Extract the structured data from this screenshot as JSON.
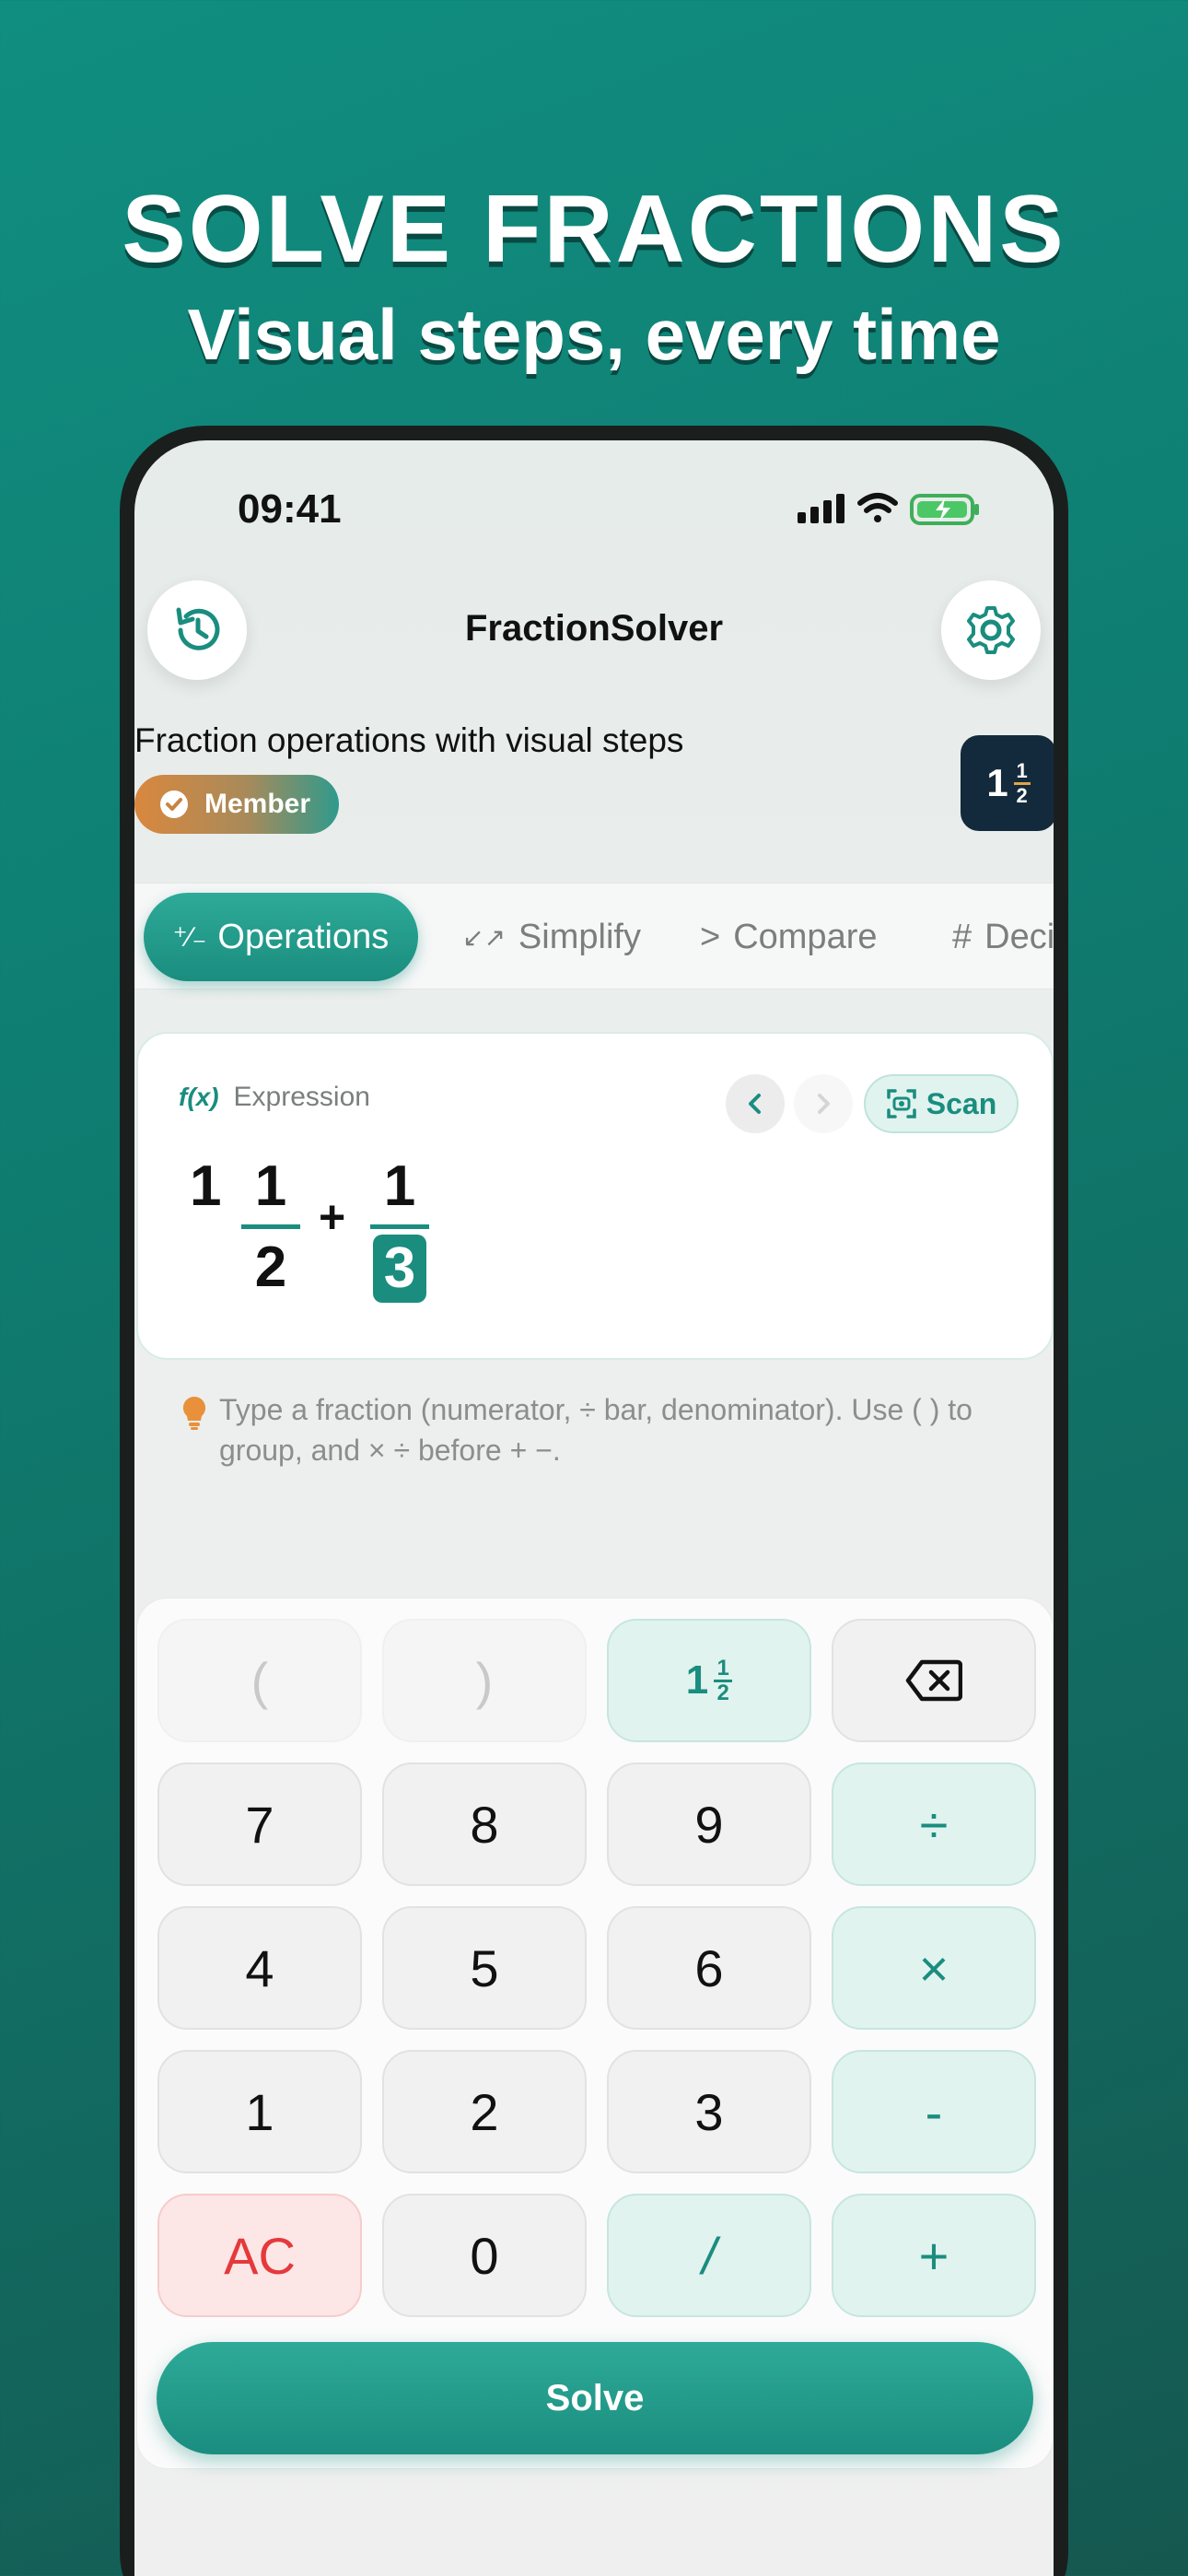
{
  "promo": {
    "headline": "SOLVE FRACTIONS",
    "subhead": "Visual steps, every time"
  },
  "status_bar": {
    "time": "09:41"
  },
  "header": {
    "title": "FractionSolver",
    "tagline": "Fraction operations with visual steps",
    "member_label": "Member",
    "badge": {
      "whole": "1",
      "numerator": "1",
      "denominator": "2"
    }
  },
  "tabs": [
    {
      "icon": "⁺∕₋",
      "label": "Operations"
    },
    {
      "icon": "↙↗",
      "label": "Simplify"
    },
    {
      "icon": ">",
      "label": "Compare"
    },
    {
      "icon": "#",
      "label": "Deci"
    }
  ],
  "expression": {
    "fx_label": "f(x)",
    "label": "Expression",
    "scan_label": "Scan",
    "whole": "1",
    "numerator1": "1",
    "denominator1": "2",
    "operator": "+",
    "numerator2": "1",
    "denominator2": "3"
  },
  "hint": "Type a fraction (numerator, ÷ bar, denominator). Use ( ) to group, and × ÷ before + −.",
  "keypad": {
    "rows": [
      [
        "(",
        ")",
        "MIXED",
        "BACKSPACE"
      ],
      [
        "7",
        "8",
        "9",
        "÷"
      ],
      [
        "4",
        "5",
        "6",
        "×"
      ],
      [
        "1",
        "2",
        "3",
        "-"
      ],
      [
        "AC",
        "0",
        "/",
        "+"
      ]
    ],
    "mixed_key": {
      "whole": "1",
      "numerator": "1",
      "denominator": "2"
    }
  },
  "solve_label": "Solve",
  "colors": {
    "accent": "#1a8d7f",
    "accent_light": "#e1f3ef",
    "danger": "#e5393b",
    "badge_bg": "#132a3d"
  }
}
